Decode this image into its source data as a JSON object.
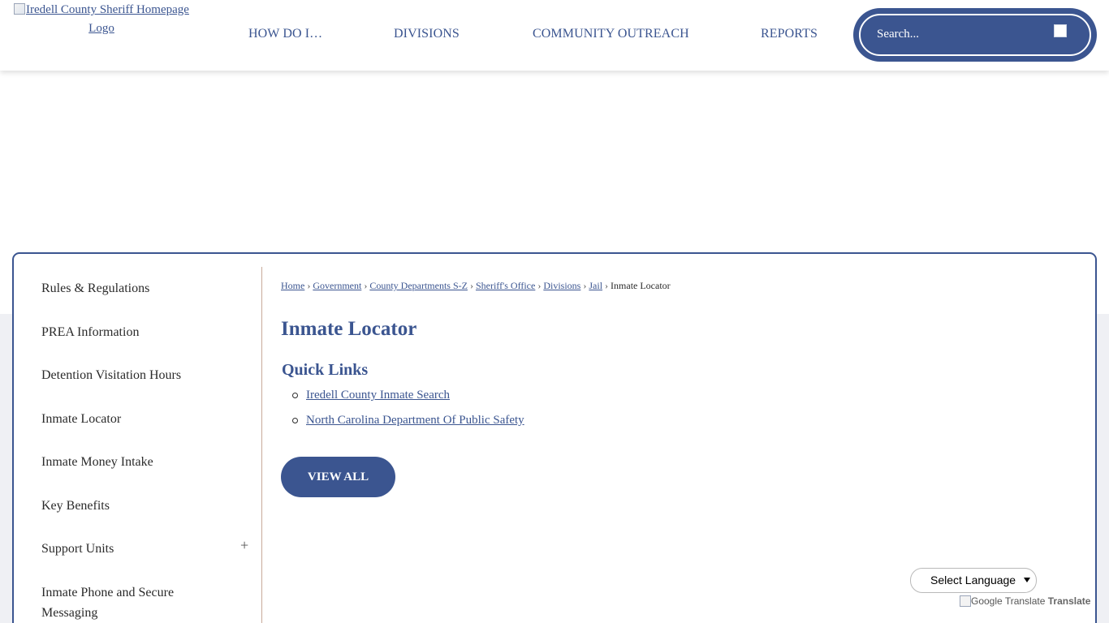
{
  "header": {
    "logo_alt": "Iredell County Sheriff Homepage Logo",
    "nav": [
      "HOW DO I…",
      "DIVISIONS",
      "COMMUNITY OUTREACH",
      "REPORTS"
    ],
    "search_placeholder": "Search..."
  },
  "sidebar": {
    "items": [
      "Rules & Regulations",
      "PREA Information",
      "Detention Visitation Hours",
      "Inmate Locator",
      "Inmate Money Intake",
      "Key Benefits",
      "Support Units",
      "Inmate Phone and Secure Messaging"
    ],
    "expand_symbol": "+"
  },
  "breadcrumb": {
    "links": [
      "Home",
      "Government",
      "County Departments S-Z",
      "Sheriff's Office",
      "Divisions",
      "Jail"
    ],
    "current": "Inmate Locator",
    "separator": "›"
  },
  "main": {
    "title": "Inmate Locator",
    "quick_links_title": "Quick Links",
    "quick_links": [
      "Iredell County Inmate Search",
      "North Carolina Department Of Public Safety"
    ],
    "view_all_label": "VIEW ALL"
  },
  "translate": {
    "select_label": "Select Language",
    "credit_img_alt": "Google Translate",
    "credit_text": "Translate"
  },
  "colors": {
    "brand": "#3b5590",
    "background_lower": "#eff0f4",
    "sidebar_divider": "#c8aa9a"
  }
}
